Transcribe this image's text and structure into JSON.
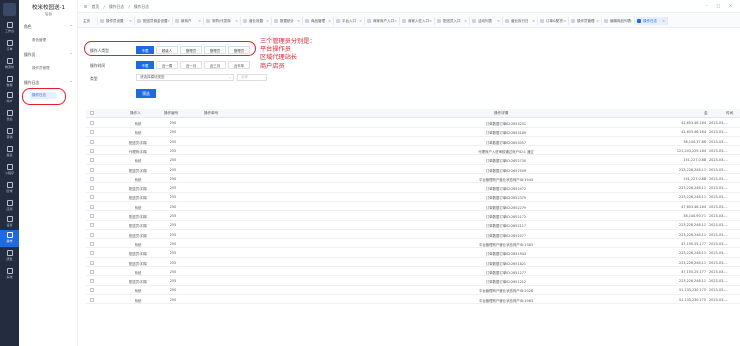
{
  "rail": {
    "items": [
      {
        "label": "工作台"
      },
      {
        "label": "订单"
      },
      {
        "label": "物流时"
      },
      {
        "label": "数据"
      },
      {
        "label": "商户"
      },
      {
        "label": "售后"
      },
      {
        "label": "营销"
      },
      {
        "label": "渠道"
      },
      {
        "label": "小程序"
      },
      {
        "label": "区域"
      },
      {
        "label": "应用"
      },
      {
        "label": "设置"
      },
      {
        "label": "操作"
      },
      {
        "label": "研发"
      },
      {
        "label": "系统"
      }
    ]
  },
  "sidebar": {
    "title": "校米校园送-1",
    "subtitle": "后台",
    "groups": [
      {
        "label": "角色",
        "links": [
          "角色管理"
        ]
      },
      {
        "label": "操作员",
        "links": [
          "操作员管理"
        ]
      },
      {
        "label": "操作日志",
        "links": [
          "操作日志"
        ]
      }
    ]
  },
  "topbar": {
    "breadcrumb": [
      "首页",
      "/",
      "操作日志",
      "/",
      "操作日志"
    ]
  },
  "tabs": [
    {
      "label": "主页"
    },
    {
      "label": "操作员设置"
    },
    {
      "label": "配送员佣金设置"
    },
    {
      "label": "新商户"
    },
    {
      "label": "采购/代发商"
    },
    {
      "label": "营业设置"
    },
    {
      "label": "数据统计"
    },
    {
      "label": "商品管理"
    },
    {
      "label": "平台入口"
    },
    {
      "label": "商家商户入口"
    },
    {
      "label": "商家入驻入口"
    },
    {
      "label": "配送员入口"
    },
    {
      "label": "活动列表"
    },
    {
      "label": "营业执行日"
    },
    {
      "label": "订单&配货"
    },
    {
      "label": "操作员管理"
    },
    {
      "label": "编辑商品列表"
    },
    {
      "label": "操作日志"
    }
  ],
  "filter": {
    "operator_type_label": "操作人类型",
    "operator_type_options": [
      "不限",
      "超级人",
      "管理员",
      "管理员",
      "管理员"
    ],
    "operator_time_label": "操作时间",
    "time_options": [
      "不限",
      "近一周",
      "近一月",
      "近三月",
      "近半年"
    ],
    "module_label": "类型",
    "module_select_value": "请选择模块类型",
    "module_input_placeholder": "名称",
    "search_button": "筛选"
  },
  "annotation": {
    "text": "三个管理员分别是：\n平台操作员\n区域代理站长\n商户店员"
  },
  "table": {
    "headers": {
      "operator": "操作人",
      "op_num": "操作编号",
      "op_no": "操作单号",
      "detail": "操作详情",
      "amount": "金",
      "time": "时间"
    },
    "rows": [
      {
        "operator": "系统",
        "num": "250",
        "detail": "订单数据订单ID:2653251",
        "amount": "41,653.46.164",
        "time": "2023-03-..."
      },
      {
        "operator": "系统",
        "num": "250",
        "detail": "订单数据订单ID:2653189",
        "amount": "41,653.46.164",
        "time": "2023-03-..."
      },
      {
        "operator": "配送员:扣除",
        "num": "255",
        "detail": "订单数据订单ID:2653057",
        "amount": "38,144.37.86",
        "time": "2023-03-..."
      },
      {
        "operator": "代理商:扣除",
        "num": "255",
        "detail": "代理商户入驻审核通过商户ID:1 通过",
        "amount": "121,243,229.164",
        "time": "2023-03-..."
      },
      {
        "operator": "系统",
        "num": "250",
        "detail": "订单数据订单ID:2652730",
        "amount": "151,227.0.88",
        "time": "2023-03-..."
      },
      {
        "operator": "配送员:扣除",
        "num": "255",
        "detail": "订单数据订单ID:2652509",
        "amount": "223,226,248.11",
        "time": "2023-03-..."
      },
      {
        "operator": "系统",
        "num": "250",
        "detail": "平台管理商户营业状态商户ID:1943",
        "amount": "151,227.0.88",
        "time": "2023-03-..."
      },
      {
        "operator": "配送员:扣除",
        "num": "255",
        "detail": "订单数据订单ID:2652472",
        "amount": "223,226,248.11",
        "time": "2023-03-..."
      },
      {
        "operator": "配送员:扣除",
        "num": "255",
        "detail": "订单数据订单ID:2652379",
        "amount": "223,226,248.11",
        "time": "2023-03-..."
      },
      {
        "operator": "系统",
        "num": "250",
        "detail": "订单数据订单ID:2652279",
        "amount": "47,653.46.164",
        "time": "2023-03-..."
      },
      {
        "operator": "配送员:扣除",
        "num": "255",
        "detail": "订单数据订单ID:2652172",
        "amount": "38,144.90.71",
        "time": "2023-03-..."
      },
      {
        "operator": "配送员:扣除",
        "num": "255",
        "detail": "订单数据订单ID:2652117",
        "amount": "223,226,248.11",
        "time": "2023-03-..."
      },
      {
        "operator": "配送员:扣除",
        "num": "255",
        "detail": "订单数据订单ID:2652077",
        "amount": "223,226,248.11",
        "time": "2023-03-..."
      },
      {
        "operator": "系统",
        "num": "250",
        "detail": "平台管理商户营业状态商户ID:2383",
        "amount": "47,155.25.177",
        "time": "2023-03-..."
      },
      {
        "operator": "配送员:扣除",
        "num": "255",
        "detail": "订单数据订单ID:2651943",
        "amount": "223,226,248.11",
        "time": "2023-03-..."
      },
      {
        "operator": "配送员:扣除",
        "num": "255",
        "detail": "订单数据订单ID:2651821",
        "amount": "223,226,248.11",
        "time": "2023-03-..."
      },
      {
        "operator": "系统",
        "num": "250",
        "detail": "订单数据订单ID:2651277",
        "amount": "47,155.25.177",
        "time": "2023-03-..."
      },
      {
        "operator": "配送员:扣除",
        "num": "255",
        "detail": "订单数据订单ID:2651212",
        "amount": "223,226,248.11",
        "time": "2023-03-..."
      },
      {
        "operator": "系统",
        "num": "250",
        "detail": "平台管理商户营业状态商户ID:2028",
        "amount": "51,133,230.175",
        "time": "2023-03-..."
      },
      {
        "operator": "系统",
        "num": "250",
        "detail": "平台管理商户营业状态商户ID:1963",
        "amount": "51,133,230.175",
        "time": "2023-03-..."
      }
    ]
  },
  "colors": {
    "accent": "#1e6ae0",
    "rail_bg": "#232d3f",
    "annotation": "#e0202a"
  }
}
